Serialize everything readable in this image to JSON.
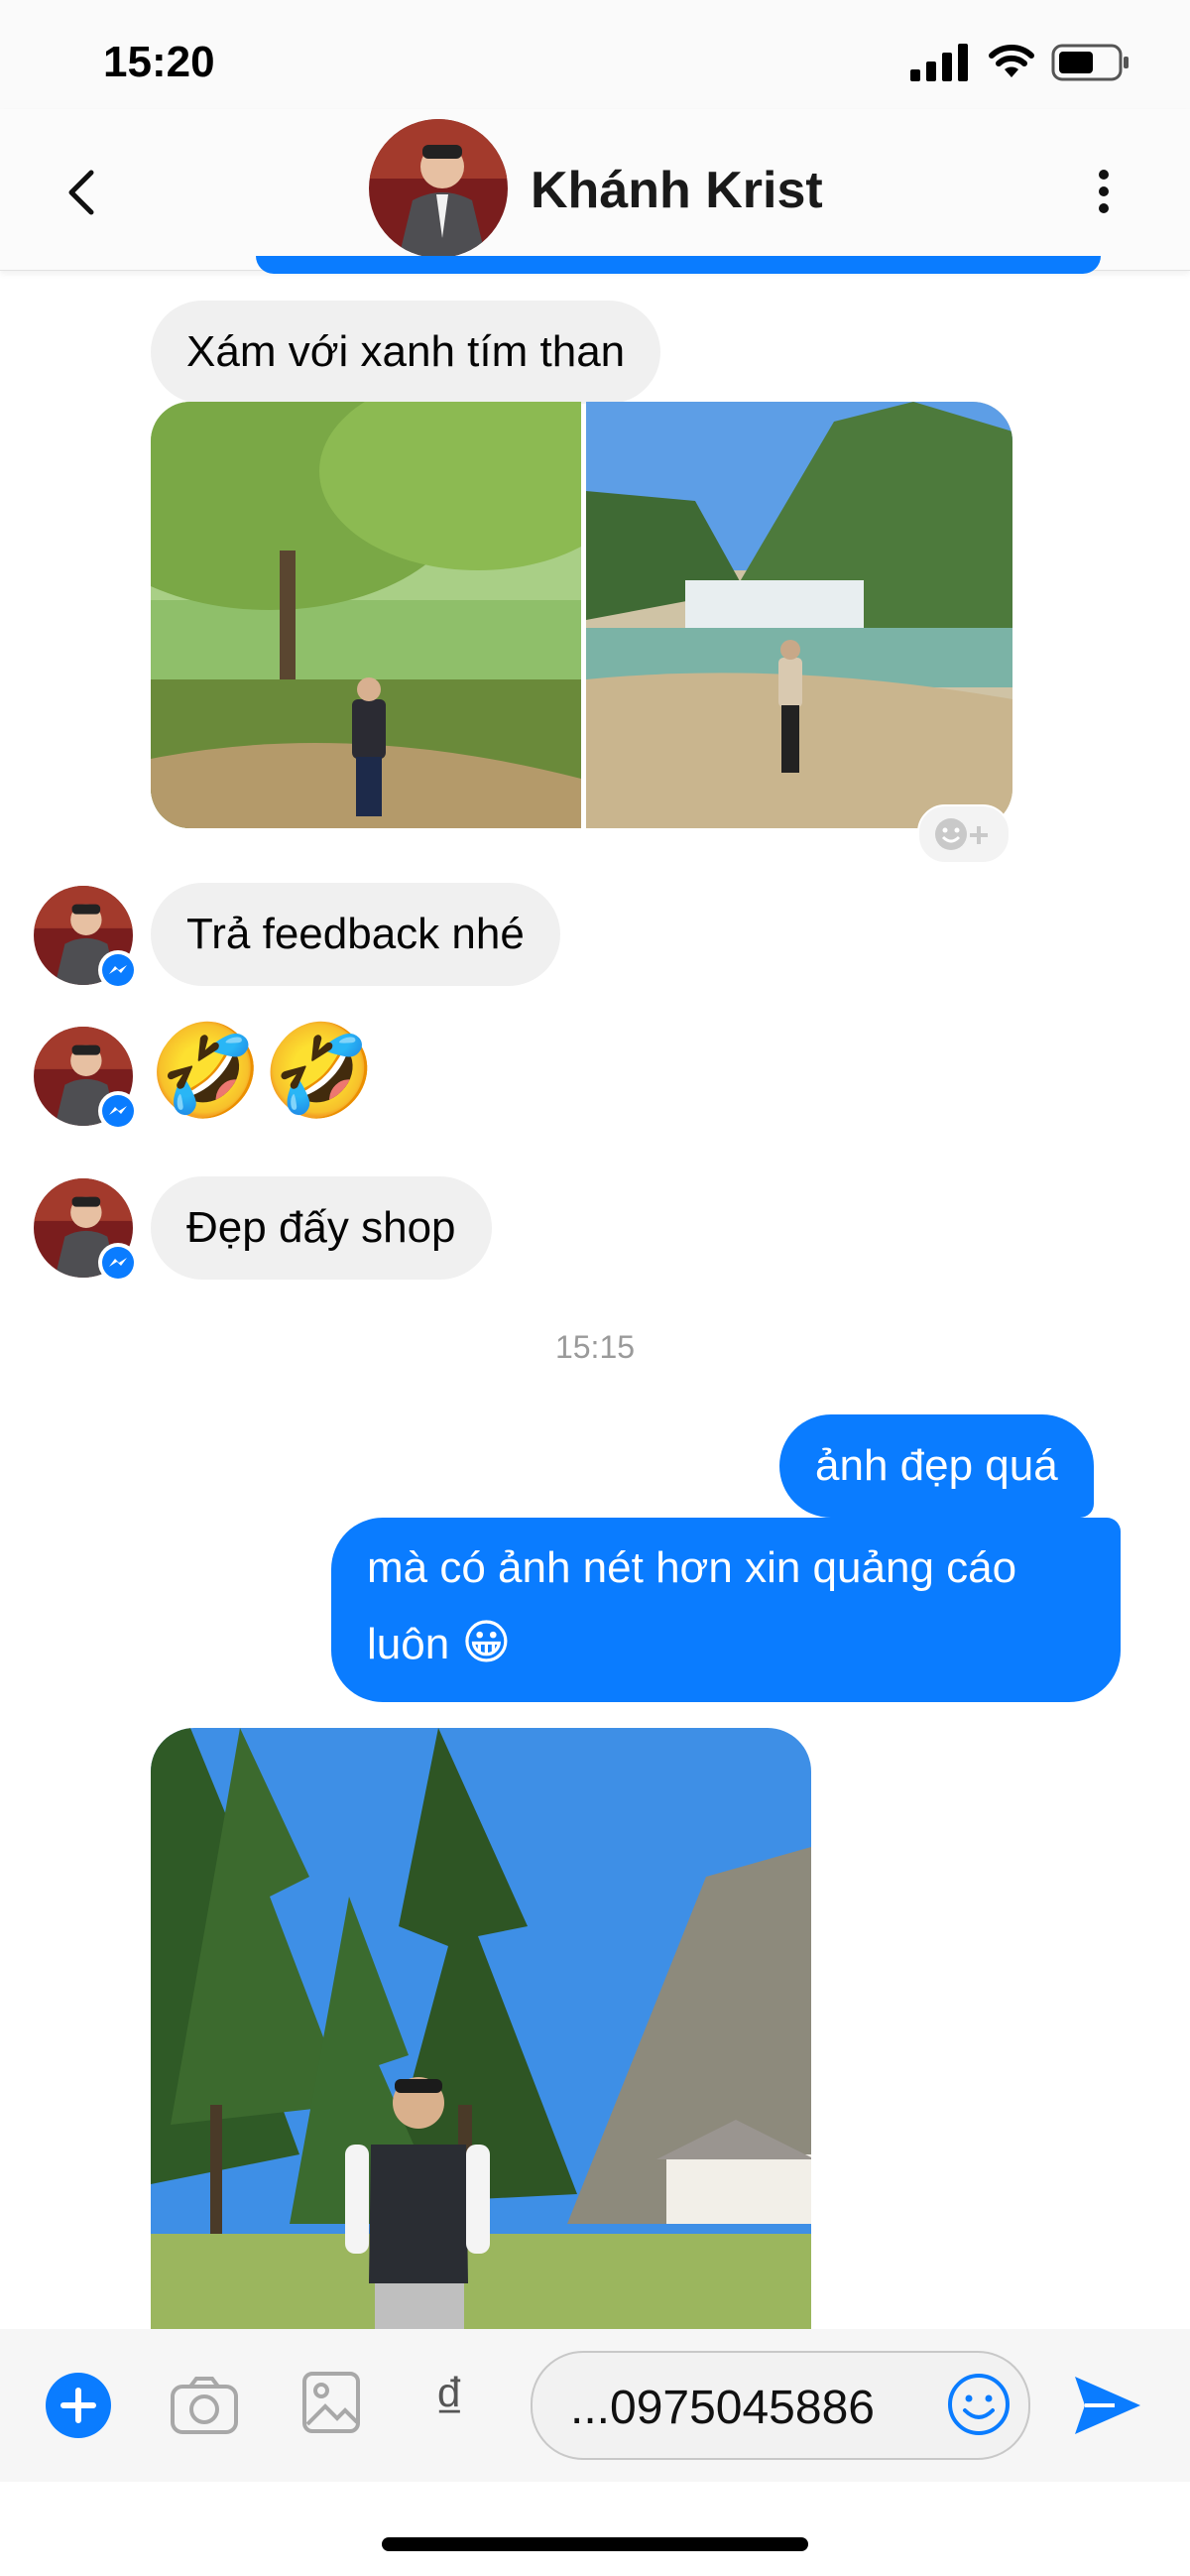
{
  "status_bar": {
    "time": "15:20"
  },
  "header": {
    "contact_name": "Khánh Krist"
  },
  "messages": {
    "m1": "Xám với xanh tím than",
    "m2": "Trả feedback nhé",
    "m3": "🤣🤣",
    "m4": "Đẹp đấy shop",
    "timestamp": "15:15",
    "m5": "ảnh đẹp quá",
    "m6_line1": "mà có ảnh nét hơn xin quảng cáo",
    "m6_line2": "luôn",
    "m6_emoji": "😀"
  },
  "composer": {
    "currency_symbol": "₫",
    "input_value": "...0975045886"
  },
  "colors": {
    "accent": "#0a7cff",
    "incoming_bubble": "#f0f0f0"
  },
  "icons": [
    "back-icon",
    "more-icon",
    "plus-icon",
    "camera-icon",
    "gallery-icon",
    "emoji-icon",
    "send-icon",
    "messenger-badge-icon",
    "add-reaction-icon",
    "signal-icon",
    "wifi-icon",
    "battery-icon"
  ]
}
